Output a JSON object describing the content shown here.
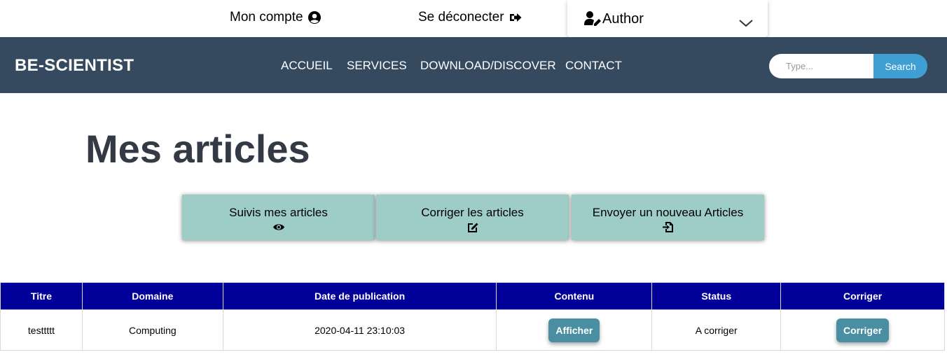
{
  "topbar": {
    "account_label": "Mon compte",
    "logout_label": "Se déconecter",
    "role_label": "Author"
  },
  "navbar": {
    "brand": "BE-SCIENTIST",
    "items": [
      {
        "label": "ACCUEIL"
      },
      {
        "label": "SERVICES"
      },
      {
        "label": "DOWNLOAD/DISCOVER"
      },
      {
        "label": "CONTACT"
      }
    ],
    "search": {
      "placeholder": "Type...",
      "value": "",
      "button_label": "Search"
    }
  },
  "page": {
    "title": "Mes articles"
  },
  "actions": [
    {
      "label": "Suivis mes articles",
      "icon": "eye-icon"
    },
    {
      "label": "Corriger les articles",
      "icon": "edit-icon"
    },
    {
      "label": "Envoyer un nouveau Articles",
      "icon": "file-import-icon"
    }
  ],
  "table": {
    "headers": [
      "Titre",
      "Domaine",
      "Date de publication",
      "Contenu",
      "Status",
      "Corriger"
    ],
    "rows": [
      {
        "titre": "testtttt",
        "domaine": "Computing",
        "date": "2020-04-11 23:10:03",
        "contenu_button": "Afficher",
        "status": "A corriger",
        "corriger_button": "Corriger"
      }
    ]
  },
  "colors": {
    "navbar": "#354a5f",
    "search_button": "#3f9fd3",
    "card": "#9ecdc8",
    "table_header": "#000099",
    "table_button": "#4a8ea2",
    "title": "#333a46"
  }
}
